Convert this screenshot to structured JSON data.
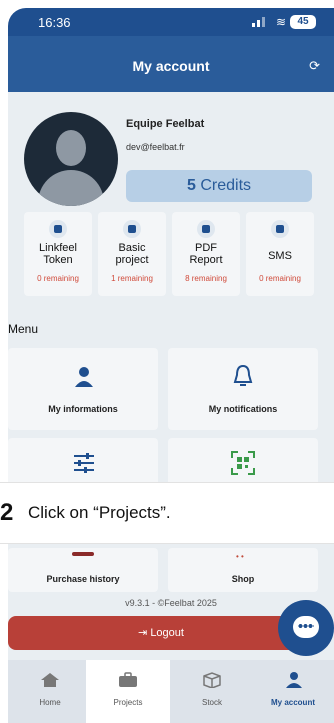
{
  "status": {
    "time": "16:36",
    "battery": "45"
  },
  "header": {
    "title": "My account",
    "refresh_icon": "refresh-icon"
  },
  "profile": {
    "name": "Equipe Feelbat",
    "email": "dev@feelbat.fr",
    "credits_count": "5",
    "credits_label": "Credits"
  },
  "resources": [
    {
      "name_line1": "Linkfeel",
      "name_line2": "Token",
      "remaining": "0 remaining",
      "icon": "star-icon"
    },
    {
      "name_line1": "Basic",
      "name_line2": "project",
      "remaining": "1 remaining",
      "icon": "folder-icon"
    },
    {
      "name_line1": "PDF",
      "name_line2": "Report",
      "remaining": "8 remaining",
      "icon": "document-icon"
    },
    {
      "name_line1": "SMS",
      "name_line2": "",
      "remaining": "0 remaining",
      "icon": "chat-icon"
    }
  ],
  "menu": {
    "label": "Menu",
    "items": [
      {
        "label": "My informations",
        "icon": "user-icon"
      },
      {
        "label": "My notifications",
        "icon": "bell-icon"
      },
      {
        "label": "",
        "icon": "sliders-icon"
      },
      {
        "label": "",
        "icon": "qr-code-icon"
      },
      {
        "label": "Purchase history",
        "icon": "history-icon"
      },
      {
        "label": "Shop",
        "icon": "shop-icon"
      }
    ]
  },
  "callout": {
    "step": "2",
    "text": "Click on “Projects”."
  },
  "version": "v9.3.1 - ©Feelbat 2025",
  "logout_label": "Logout",
  "nav": {
    "items": [
      {
        "label": "Home",
        "icon": "home-icon"
      },
      {
        "label": "Projects",
        "icon": "briefcase-icon"
      },
      {
        "label": "Stock",
        "icon": "box-icon"
      },
      {
        "label": "My account",
        "icon": "user-icon"
      }
    ]
  },
  "colors": {
    "primary": "#1f4f8f",
    "danger": "#b84038",
    "remaining": "#d04a3a"
  }
}
